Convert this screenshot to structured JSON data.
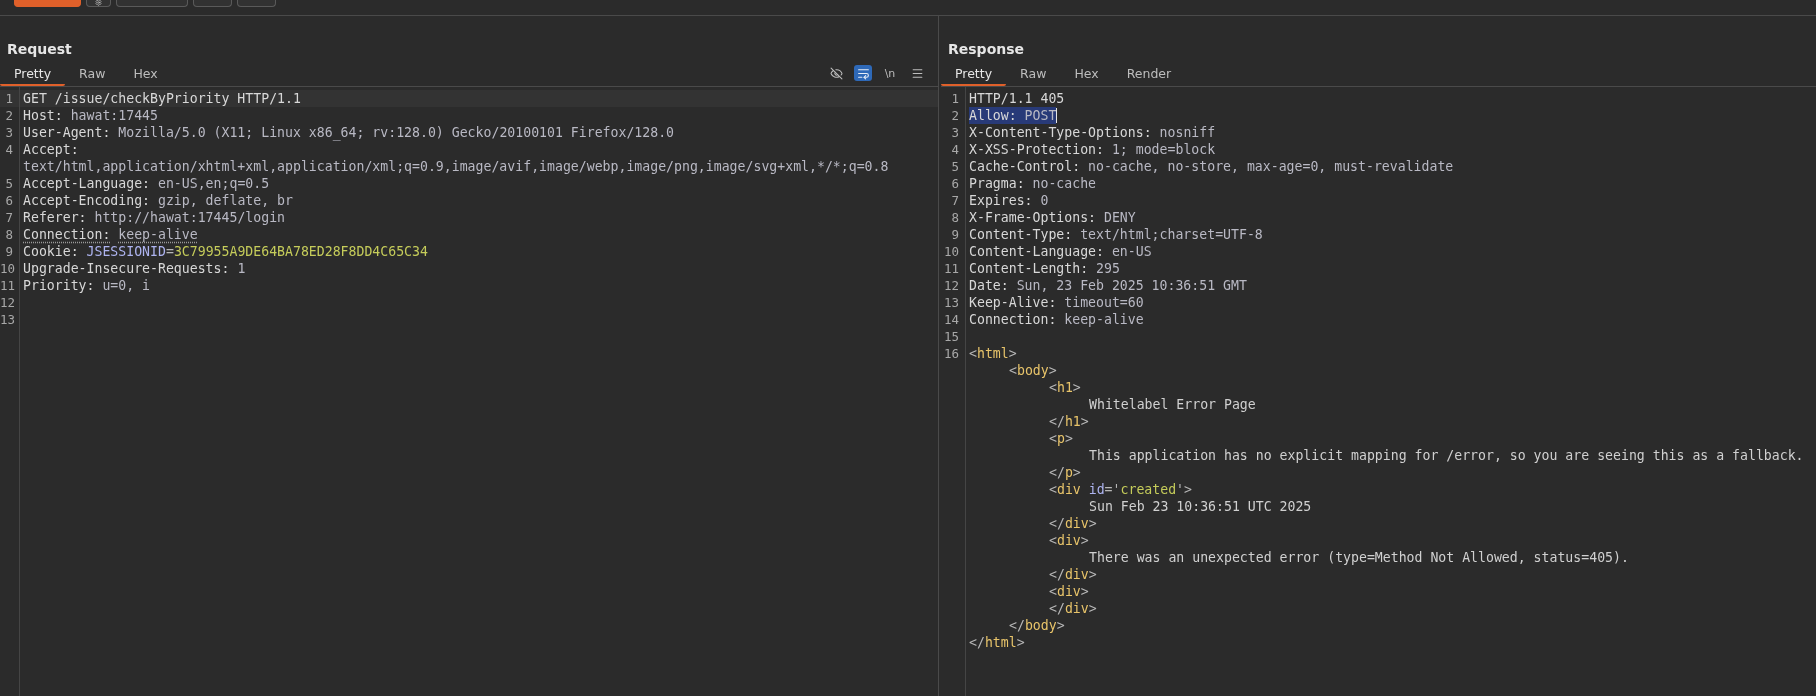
{
  "toolbar": {
    "buttons": [
      {
        "kind": "primary"
      },
      {
        "kind": "gear"
      },
      {
        "kind": "wide"
      },
      {
        "kind": "small"
      },
      {
        "kind": "small"
      }
    ]
  },
  "request": {
    "title": "Request",
    "tabs": [
      {
        "label": "Pretty",
        "selected": true
      },
      {
        "label": "Raw",
        "selected": false
      },
      {
        "label": "Hex",
        "selected": false
      }
    ],
    "tools": [
      {
        "kind": "hide",
        "on": false
      },
      {
        "kind": "wrap",
        "on": true
      },
      {
        "kind": "newlines",
        "label": "\\n",
        "on": false
      },
      {
        "kind": "menu",
        "on": false
      }
    ],
    "lines": [
      {
        "number": "1",
        "kind": "current",
        "segments": [
          {
            "kind": "name",
            "text": "GET /issue/checkByPriority HTTP/1.1"
          }
        ]
      },
      {
        "number": "2",
        "kind": "normal",
        "segments": [
          {
            "kind": "name",
            "text": "Host:"
          },
          {
            "kind": "value",
            "text": "hawat:17445"
          }
        ]
      },
      {
        "number": "3",
        "kind": "normal",
        "segments": [
          {
            "kind": "name",
            "text": "User-Agent:"
          },
          {
            "kind": "value",
            "text": "Mozilla/5.0 (X11; Linux x86_64; rv:128.0) Gecko/20100101 Firefox/128.0"
          }
        ]
      },
      {
        "number": "4",
        "kind": "wrapped",
        "segments": [
          {
            "kind": "name",
            "text": "Accept:"
          },
          {
            "kind": "value",
            "text": "text/html,application/xhtml+xml,application/xml;q=0.9,image/avif,image/webp,image/png,image/svg+xml,*/*;q=0.8"
          }
        ]
      },
      {
        "number": "5",
        "kind": "normal",
        "segments": [
          {
            "kind": "name",
            "text": "Accept-Language:"
          },
          {
            "kind": "value",
            "text": "en-US,en;q=0.5"
          }
        ]
      },
      {
        "number": "6",
        "kind": "normal",
        "segments": [
          {
            "kind": "name",
            "text": "Accept-Encoding:"
          },
          {
            "kind": "value",
            "text": "gzip, deflate, br"
          }
        ]
      },
      {
        "number": "7",
        "kind": "normal",
        "segments": [
          {
            "kind": "name",
            "text": "Referer:"
          },
          {
            "kind": "value",
            "text": "http://hawat:17445/login"
          }
        ]
      },
      {
        "number": "8",
        "kind": "flagged",
        "segments": [
          {
            "kind": "name",
            "text": "Connection:"
          },
          {
            "kind": "value",
            "text": "keep-alive"
          }
        ]
      },
      {
        "number": "9",
        "kind": "normal",
        "segments": [
          {
            "kind": "name",
            "text": "Cookie:"
          },
          {
            "kind": "attr",
            "text": "JSESSIONID"
          },
          {
            "kind": "punct",
            "text": "="
          },
          {
            "kind": "attr-value",
            "text": "3C79955A9DE64BA78ED28F8DD4C65C34"
          }
        ]
      },
      {
        "number": "10",
        "kind": "normal",
        "segments": [
          {
            "kind": "name",
            "text": "Upgrade-Insecure-Requests:"
          },
          {
            "kind": "value",
            "text": "1"
          }
        ]
      },
      {
        "number": "11",
        "kind": "normal",
        "segments": [
          {
            "kind": "name",
            "text": "Priority:"
          },
          {
            "kind": "value",
            "text": "u=0, i"
          }
        ]
      },
      {
        "number": "12",
        "kind": "normal"
      },
      {
        "number": "13",
        "kind": "normal"
      }
    ]
  },
  "response": {
    "title": "Response",
    "tabs": [
      {
        "label": "Pretty",
        "selected": true
      },
      {
        "label": "Raw",
        "selected": false
      },
      {
        "label": "Hex",
        "selected": false
      },
      {
        "label": "Render",
        "selected": false
      }
    ],
    "lines": [
      {
        "number": "1",
        "kind": "normal",
        "segments": [
          {
            "kind": "name",
            "text": "HTTP/1.1 405"
          }
        ]
      },
      {
        "number": "2",
        "kind": "selected",
        "segments": [
          {
            "kind": "name",
            "text": "Allow:"
          },
          {
            "kind": "value",
            "text": "POST"
          }
        ]
      },
      {
        "number": "3",
        "kind": "normal",
        "segments": [
          {
            "kind": "name",
            "text": "X-Content-Type-Options:"
          },
          {
            "kind": "value",
            "text": "nosniff"
          }
        ]
      },
      {
        "number": "4",
        "kind": "normal",
        "segments": [
          {
            "kind": "name",
            "text": "X-XSS-Protection:"
          },
          {
            "kind": "value",
            "text": "1; mode=block"
          }
        ]
      },
      {
        "number": "5",
        "kind": "normal",
        "segments": [
          {
            "kind": "name",
            "text": "Cache-Control:"
          },
          {
            "kind": "value",
            "text": "no-cache, no-store, max-age=0, must-revalidate"
          }
        ]
      },
      {
        "number": "6",
        "kind": "normal",
        "segments": [
          {
            "kind": "name",
            "text": "Pragma:"
          },
          {
            "kind": "value",
            "text": "no-cache"
          }
        ]
      },
      {
        "number": "7",
        "kind": "normal",
        "segments": [
          {
            "kind": "name",
            "text": "Expires:"
          },
          {
            "kind": "value",
            "text": "0"
          }
        ]
      },
      {
        "number": "8",
        "kind": "normal",
        "segments": [
          {
            "kind": "name",
            "text": "X-Frame-Options:"
          },
          {
            "kind": "value",
            "text": "DENY"
          }
        ]
      },
      {
        "number": "9",
        "kind": "normal",
        "segments": [
          {
            "kind": "name",
            "text": "Content-Type:"
          },
          {
            "kind": "value",
            "text": "text/html;charset=UTF-8"
          }
        ]
      },
      {
        "number": "10",
        "kind": "normal",
        "segments": [
          {
            "kind": "name",
            "text": "Content-Language:"
          },
          {
            "kind": "value",
            "text": "en-US"
          }
        ]
      },
      {
        "number": "11",
        "kind": "normal",
        "segments": [
          {
            "kind": "name",
            "text": "Content-Length:"
          },
          {
            "kind": "value",
            "text": "295"
          }
        ]
      },
      {
        "number": "12",
        "kind": "normal",
        "segments": [
          {
            "kind": "name",
            "text": "Date:"
          },
          {
            "kind": "value",
            "text": "Sun, 23 Feb 2025 10:36:51 GMT"
          }
        ]
      },
      {
        "number": "13",
        "kind": "normal",
        "segments": [
          {
            "kind": "name",
            "text": "Keep-Alive:"
          },
          {
            "kind": "value",
            "text": "timeout=60"
          }
        ]
      },
      {
        "number": "14",
        "kind": "normal",
        "segments": [
          {
            "kind": "name",
            "text": "Connection:"
          },
          {
            "kind": "value",
            "text": "keep-alive"
          }
        ]
      },
      {
        "number": "15",
        "kind": "normal"
      }
    ],
    "html": {
      "number": "16",
      "open": [
        {
          "kind": "punct",
          "text": "<"
        },
        {
          "kind": "tag",
          "text": "html"
        },
        {
          "kind": "punct",
          "text": ">"
        }
      ],
      "close": [
        {
          "kind": "punct",
          "text": "</"
        },
        {
          "kind": "tag",
          "text": "html"
        },
        {
          "kind": "punct",
          "text": ">"
        }
      ],
      "children": [
        {
          "open": [
            {
              "kind": "punct",
              "text": "<"
            },
            {
              "kind": "tag",
              "text": "body"
            },
            {
              "kind": "punct",
              "text": ">"
            }
          ],
          "close": [
            {
              "kind": "punct",
              "text": "</"
            },
            {
              "kind": "tag",
              "text": "body"
            },
            {
              "kind": "punct",
              "text": ">"
            }
          ],
          "children": [
            {
              "open": [
                {
                  "kind": "punct",
                  "text": "<"
                },
                {
                  "kind": "tag",
                  "text": "h1"
                },
                {
                  "kind": "punct",
                  "text": ">"
                }
              ],
              "close": [
                {
                  "kind": "punct",
                  "text": "</"
                },
                {
                  "kind": "tag",
                  "text": "h1"
                },
                {
                  "kind": "punct",
                  "text": ">"
                }
              ],
              "children": [
                {
                  "segments": [
                    {
                      "kind": "text",
                      "text": "Whitelabel Error Page"
                    }
                  ]
                }
              ]
            },
            {
              "open": [
                {
                  "kind": "punct",
                  "text": "<"
                },
                {
                  "kind": "tag",
                  "text": "p"
                },
                {
                  "kind": "punct",
                  "text": ">"
                }
              ],
              "close": [
                {
                  "kind": "punct",
                  "text": "</"
                },
                {
                  "kind": "tag",
                  "text": "p"
                },
                {
                  "kind": "punct",
                  "text": ">"
                }
              ],
              "children": [
                {
                  "segments": [
                    {
                      "kind": "text",
                      "text": "This application has no explicit mapping for /error, so you are seeing this as a fallback."
                    }
                  ]
                }
              ]
            },
            {
              "open": [
                {
                  "kind": "punct",
                  "text": "<"
                },
                {
                  "kind": "tag",
                  "text": "div"
                },
                {
                  "kind": "attr",
                  "text": "id"
                },
                {
                  "kind": "punct",
                  "text": "='"
                },
                {
                  "kind": "attr-value",
                  "text": "created"
                },
                {
                  "kind": "punct",
                  "text": "'>"
                }
              ],
              "close": [
                {
                  "kind": "punct",
                  "text": "</"
                },
                {
                  "kind": "tag",
                  "text": "div"
                },
                {
                  "kind": "punct",
                  "text": ">"
                }
              ],
              "children": [
                {
                  "segments": [
                    {
                      "kind": "text",
                      "text": "Sun Feb 23 10:36:51 UTC 2025"
                    }
                  ]
                }
              ]
            },
            {
              "open": [
                {
                  "kind": "punct",
                  "text": "<"
                },
                {
                  "kind": "tag",
                  "text": "div"
                },
                {
                  "kind": "punct",
                  "text": ">"
                }
              ],
              "close": [
                {
                  "kind": "punct",
                  "text": "</"
                },
                {
                  "kind": "tag",
                  "text": "div"
                },
                {
                  "kind": "punct",
                  "text": ">"
                }
              ],
              "children": [
                {
                  "segments": [
                    {
                      "kind": "text",
                      "text": "There was an unexpected error (type=Method Not Allowed, status=405)."
                    }
                  ]
                }
              ]
            },
            {
              "open": [
                {
                  "kind": "punct",
                  "text": "<"
                },
                {
                  "kind": "tag",
                  "text": "div"
                },
                {
                  "kind": "punct",
                  "text": ">"
                }
              ],
              "close": [
                {
                  "kind": "punct",
                  "text": "</"
                },
                {
                  "kind": "tag",
                  "text": "div"
                },
                {
                  "kind": "punct",
                  "text": ">"
                }
              ]
            }
          ]
        }
      ]
    }
  }
}
